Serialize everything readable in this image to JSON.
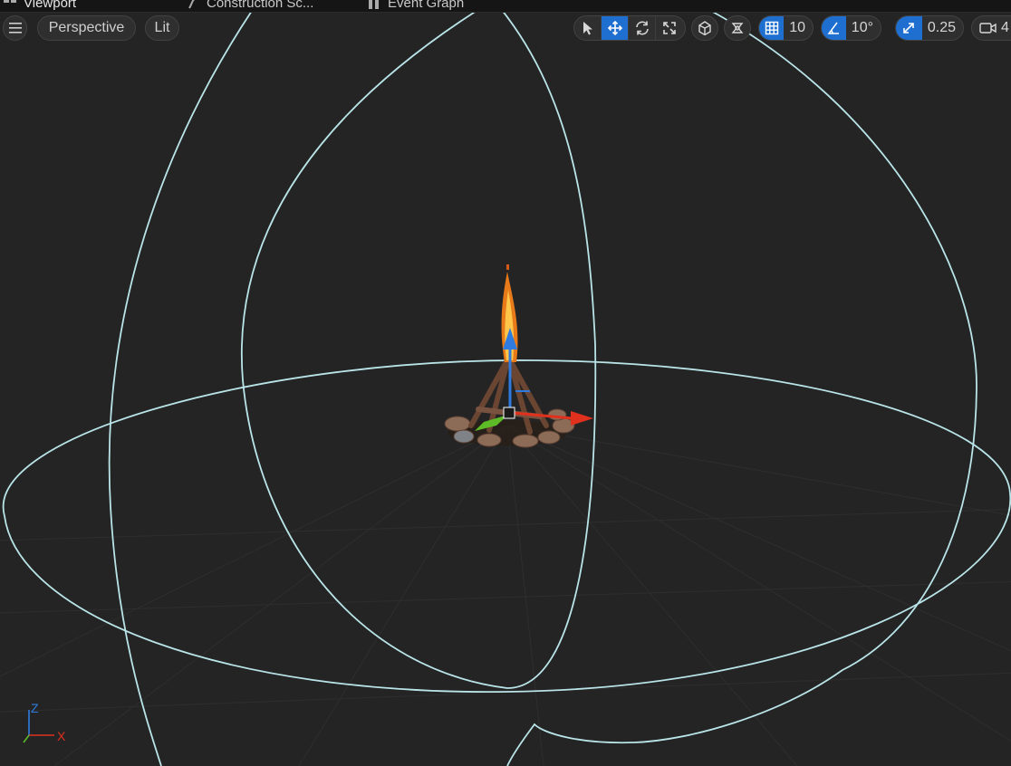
{
  "tabs": {
    "viewport": "Viewport",
    "construction": "Construction Sc...",
    "event_graph": "Event Graph"
  },
  "toolbar": {
    "view_mode": "Perspective",
    "lighting": "Lit",
    "grid_snap_value": "10",
    "rotation_snap_value": "10°",
    "scale_snap_value": "0.25",
    "camera_speed_value": "4"
  },
  "axis_labels": {
    "z": "Z",
    "x": "X"
  },
  "colors": {
    "background": "#242424",
    "accent": "#1f6fd1",
    "bounds_circle": "#b9e4e8",
    "axis_x": "#e0301e",
    "axis_y": "#5dbb28",
    "axis_z": "#2f7be0"
  },
  "icons": {
    "menu": "hamburger-icon",
    "select": "cursor-arrow-icon",
    "translate": "move-arrows-icon",
    "rotate": "rotate-icon",
    "scale": "scale-icon",
    "world_local": "world-icon",
    "surface_snap": "surface-snap-icon",
    "grid": "grid-icon",
    "angle": "angle-icon",
    "scale_snap": "scale-arrow-icon",
    "camera": "camera-icon"
  }
}
